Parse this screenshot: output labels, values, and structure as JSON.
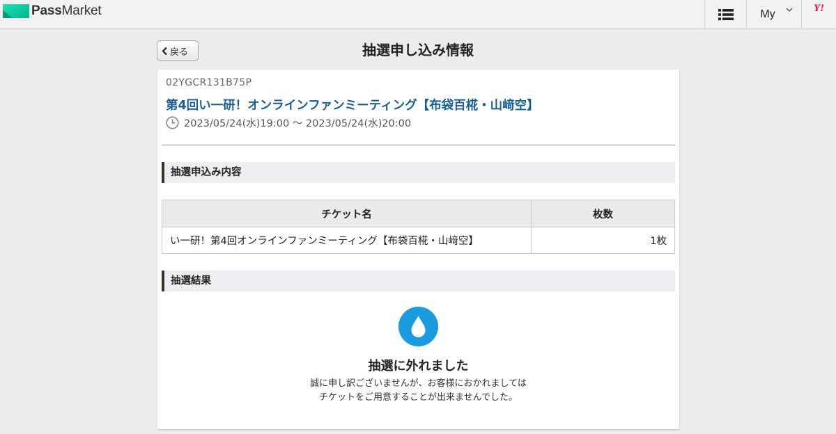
{
  "header": {
    "logo_bold": "Pass",
    "logo_light": "Market",
    "my_label": "My",
    "yj_label": "Y!",
    "brand_color": "#00c9a0"
  },
  "titlebar": {
    "back_label": "戻る",
    "title": "抽選申し込み情報"
  },
  "event": {
    "code": "02YGCR131B75P",
    "title": "第4回い一研！オンラインファンミーティング【布袋百椛・山﨑空】",
    "datetime": "2023/05/24(水)19:00 〜 2023/05/24(水)20:00"
  },
  "application": {
    "section_title": "抽選申込み内容",
    "columns": [
      "チケット名",
      "枚数"
    ],
    "rows": [
      {
        "name": "い一研！第4回オンラインファンミーティング【布袋百椛・山﨑空】",
        "qty": "1枚"
      }
    ]
  },
  "result": {
    "section_title": "抽選結果",
    "icon": "water-drop-icon",
    "icon_color": "#1a9be0",
    "title": "抽選に外れました",
    "message_line1": "誠に申し訳ございませんが、お客様におかれましては",
    "message_line2": "チケットをご用意することが出来ませんでした。"
  }
}
